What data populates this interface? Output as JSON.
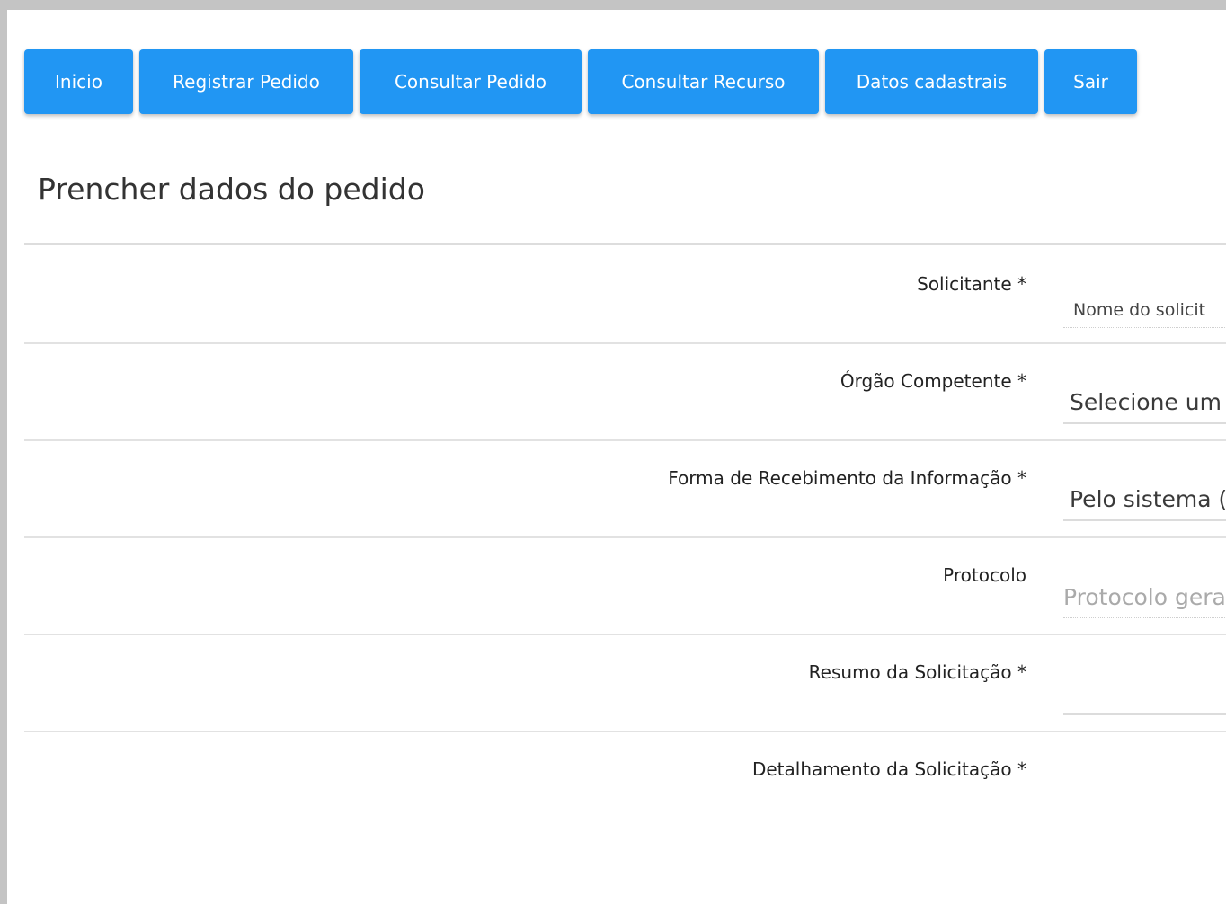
{
  "nav": {
    "items": [
      {
        "label": "Inicio"
      },
      {
        "label": "Registrar Pedido"
      },
      {
        "label": "Consultar Pedido"
      },
      {
        "label": "Consultar Recurso"
      },
      {
        "label": "Datos cadastrais"
      },
      {
        "label": "Sair"
      }
    ]
  },
  "form": {
    "title": "Prencher dados do pedido",
    "fields": {
      "solicitante": {
        "label": "Solicitante *",
        "value": "Nome do solicit"
      },
      "orgao": {
        "label": "Órgão Competente *",
        "value": "Selecione um"
      },
      "forma": {
        "label": "Forma de Recebimento da Informação *",
        "value": "Pelo sistema ("
      },
      "protocolo": {
        "label": "Protocolo",
        "placeholder": "Protocolo gera"
      },
      "resumo": {
        "label": "Resumo da Solicitação *",
        "value": ""
      },
      "detalhamento": {
        "label": "Detalhamento da Solicitação *",
        "value": ""
      }
    }
  },
  "colors": {
    "accent": "#2196f3",
    "frame": "#c4c4c4"
  }
}
